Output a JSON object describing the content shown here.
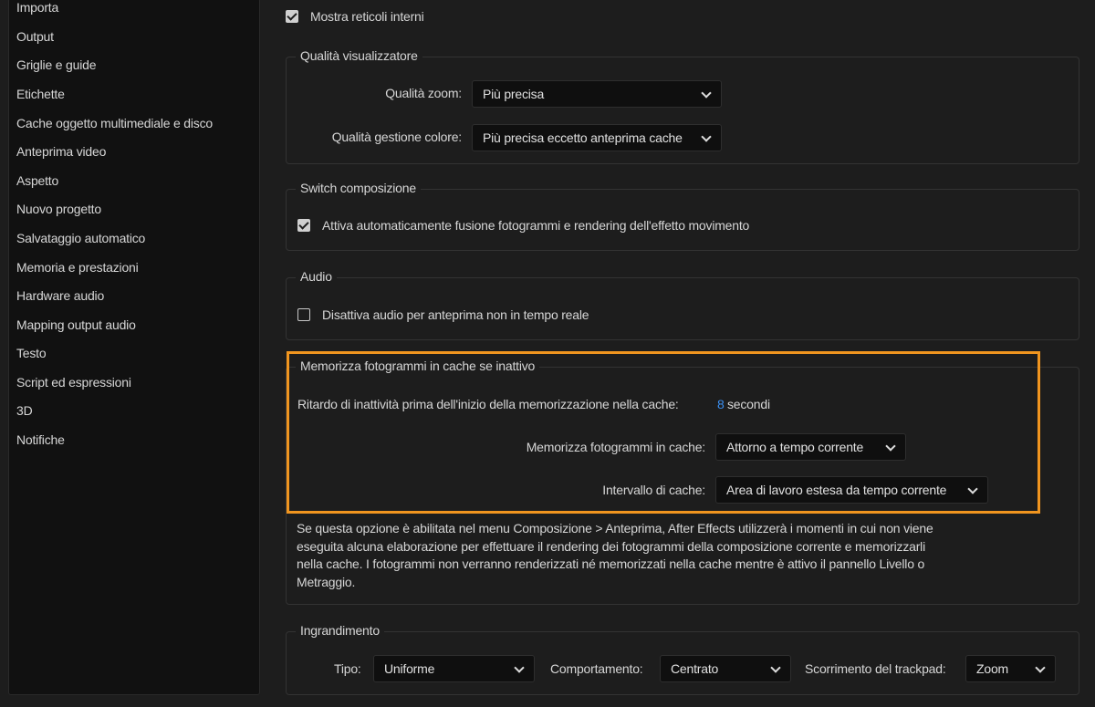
{
  "sidebar": {
    "items": [
      "Importa",
      "Output",
      "Griglie e guide",
      "Etichette",
      "Cache oggetto multimediale e disco",
      "Anteprima video",
      "Aspetto",
      "Nuovo progetto",
      "Salvataggio automatico",
      "Memoria e prestazioni",
      "Hardware audio",
      "Mapping output audio",
      "Testo",
      "Script ed espressioni",
      "3D",
      "Notifiche"
    ]
  },
  "top": {
    "show_grids_label": "Mostra reticoli interni",
    "show_grids_checked": true
  },
  "viewer_quality": {
    "title": "Qualità visualizzatore",
    "zoom_label": "Qualità zoom:",
    "zoom_value": "Più precisa",
    "color_label": "Qualità gestione colore:",
    "color_value": "Più precisa eccetto anteprima cache"
  },
  "switch": {
    "title": "Switch composizione",
    "option_label": "Attiva automaticamente fusione fotogrammi e rendering dell'effetto movimento",
    "checked": true
  },
  "audio": {
    "title": "Audio",
    "option_label": "Disattiva audio per anteprima non in tempo reale",
    "checked": false
  },
  "cache_idle": {
    "title": "Memorizza fotogrammi in cache se inattivo",
    "delay_label": "Ritardo di inattività prima dell'inizio della memorizzazione nella cache:",
    "delay_value": "8",
    "delay_unit": "secondi",
    "cache_frames_label": "Memorizza fotogrammi in cache:",
    "cache_frames_value": "Attorno a tempo corrente",
    "range_label": "Intervallo di cache:",
    "range_value": "Area di lavoro estesa da tempo corrente",
    "description": "Se questa opzione è abilitata nel menu Composizione > Anteprima, After Effects utilizzerà i momenti in cui non viene eseguita alcuna elaborazione per effettuare il rendering dei fotogrammi della composizione corrente e memorizzarli nella cache. I fotogrammi non verranno renderizzati né memorizzati nella cache mentre è attivo il pannello Livello o Metraggio."
  },
  "magnification": {
    "title": "Ingrandimento",
    "type_label": "Tipo:",
    "type_value": "Uniforme",
    "behavior_label": "Comportamento:",
    "behavior_value": "Centrato",
    "trackpad_label": "Scorrimento del trackpad:",
    "trackpad_value": "Zoom"
  },
  "colors": {
    "highlight": "#f0951f",
    "link": "#3a8ef0"
  }
}
